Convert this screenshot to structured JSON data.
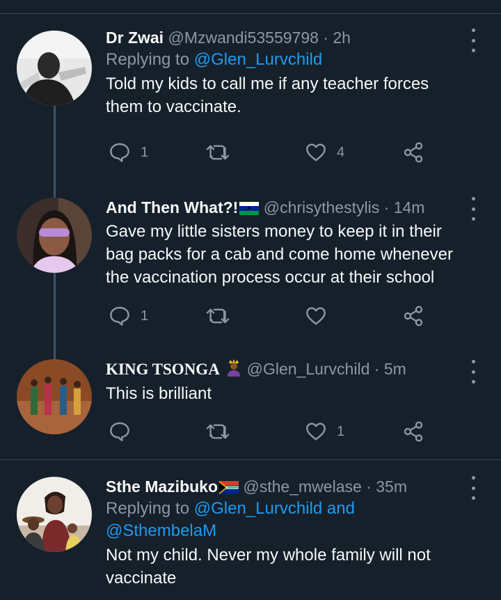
{
  "tweets": [
    {
      "name": "Dr Zwai",
      "handle": "@Mzwandi53559798",
      "dot": "·",
      "time": "2h",
      "replying_prefix": "Replying to ",
      "replying_to": "@Glen_Lurvchild",
      "text": "Told my kids to call me if any teacher forces them to vaccinate.",
      "reply_count": "1",
      "retweet_count": "",
      "like_count": "4"
    },
    {
      "name": "And Then What?!",
      "name_emoji": "flag-lesotho",
      "handle": "@chrisythestylis",
      "dot": "·",
      "time": "14m",
      "text": "Gave my little sisters money to keep it in their bag packs for a cab and come home whenever the vaccination process occur at their school",
      "reply_count": "1",
      "retweet_count": "",
      "like_count": ""
    },
    {
      "name": "KING TSONGA",
      "name_emoji": "prince-emoji",
      "handle": "@Glen_Lurvchild",
      "dot": "·",
      "time": "5m",
      "text": "This is brilliant",
      "reply_count": "",
      "retweet_count": "",
      "like_count": "1"
    },
    {
      "name": "Sthe Mazibuko",
      "name_emoji": "flag-south-africa",
      "handle": "@sthe_mwelase",
      "dot": "·",
      "time": "35m",
      "replying_prefix": "Replying to ",
      "replying_to": "@Glen_Lurvchild and @SthembelaM",
      "text": "Not my child. Never my whole family will not vaccinate"
    }
  ],
  "colors": {
    "background": "#15202b",
    "text": "#f7f9f9",
    "muted": "#8b98a5",
    "link": "#1d9bf0",
    "divider": "#38444d"
  },
  "icons": [
    "reply-icon",
    "retweet-icon",
    "like-icon",
    "share-icon",
    "more-icon"
  ]
}
